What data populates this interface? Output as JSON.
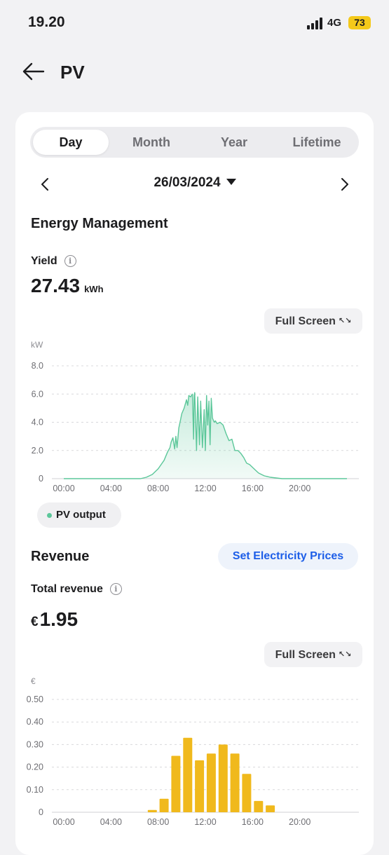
{
  "status": {
    "time": "19.20",
    "network": "4G",
    "battery": "73"
  },
  "header": {
    "title": "PV"
  },
  "tabs": [
    {
      "label": "Day",
      "active": true
    },
    {
      "label": "Month",
      "active": false
    },
    {
      "label": "Year",
      "active": false
    },
    {
      "label": "Lifetime",
      "active": false
    }
  ],
  "date": "26/03/2024",
  "energy": {
    "title": "Energy Management",
    "yield_label": "Yield",
    "yield_value": "27.43",
    "yield_unit": "kWh",
    "fullscreen_label": "Full Screen",
    "legend": "PV output"
  },
  "revenue": {
    "title": "Revenue",
    "set_prices_label": "Set Electricity Prices",
    "total_label": "Total revenue",
    "currency": "€",
    "total_value": "1.95",
    "fullscreen_label": "Full Screen"
  },
  "chart_data": [
    {
      "type": "area",
      "ylabel": "kW",
      "ylim": [
        0,
        8
      ],
      "yticks": [
        "8.0",
        "6.0",
        "4.0",
        "2.0",
        "0"
      ],
      "xticks": [
        "00:00",
        "04:00",
        "08:00",
        "12:00",
        "16:00",
        "20:00"
      ],
      "series": [
        {
          "name": "PV output",
          "color": "#5cc79a",
          "x": [
            0,
            6.5,
            7.0,
            7.5,
            8.0,
            8.5,
            8.8,
            9.0,
            9.1,
            9.25,
            9.4,
            9.5,
            9.6,
            9.75,
            9.9,
            10.0,
            10.2,
            10.4,
            10.5,
            10.6,
            10.75,
            10.9,
            11.0,
            11.05,
            11.1,
            11.25,
            11.35,
            11.5,
            11.6,
            11.75,
            11.9,
            12.0,
            12.1,
            12.2,
            12.3,
            12.4,
            12.5,
            12.6,
            12.75,
            12.85,
            13.0,
            13.25,
            13.5,
            13.75,
            14.0,
            14.25,
            14.5,
            14.75,
            15.0,
            15.25,
            15.5,
            15.75,
            16.0,
            16.25,
            16.5,
            16.75,
            17.0,
            17.5,
            18.0,
            18.5,
            20.0,
            24.0
          ],
          "y": [
            0,
            0,
            0.1,
            0.3,
            0.7,
            1.3,
            1.9,
            2.2,
            2.6,
            2.9,
            2.1,
            3.0,
            2.2,
            3.6,
            4.2,
            4.6,
            5.0,
            5.6,
            5.2,
            5.9,
            5.8,
            6.0,
            2.8,
            5.9,
            6.1,
            2.0,
            5.8,
            2.4,
            5.5,
            2.2,
            4.9,
            2.0,
            5.9,
            3.8,
            5.5,
            2.4,
            5.7,
            4.3,
            4.0,
            4.1,
            3.9,
            4.0,
            3.8,
            3.2,
            2.7,
            2.8,
            2.0,
            2.0,
            1.8,
            1.5,
            1.1,
            1.0,
            0.8,
            0.6,
            0.4,
            0.3,
            0.2,
            0.1,
            0.05,
            0,
            0,
            0
          ]
        }
      ]
    },
    {
      "type": "bar",
      "ylabel": "€",
      "ylim": [
        0,
        0.5
      ],
      "yticks": [
        "0.50",
        "0.40",
        "0.30",
        "0.20",
        "0.10",
        "0"
      ],
      "xticks": [
        "00:00",
        "04:00",
        "08:00",
        "12:00",
        "16:00",
        "20:00"
      ],
      "categories": [
        7,
        8,
        9,
        10,
        11,
        12,
        13,
        14,
        15,
        16,
        17
      ],
      "values": [
        0.01,
        0.06,
        0.25,
        0.33,
        0.23,
        0.26,
        0.3,
        0.26,
        0.17,
        0.05,
        0.03
      ],
      "color": "#f0b91c"
    }
  ]
}
